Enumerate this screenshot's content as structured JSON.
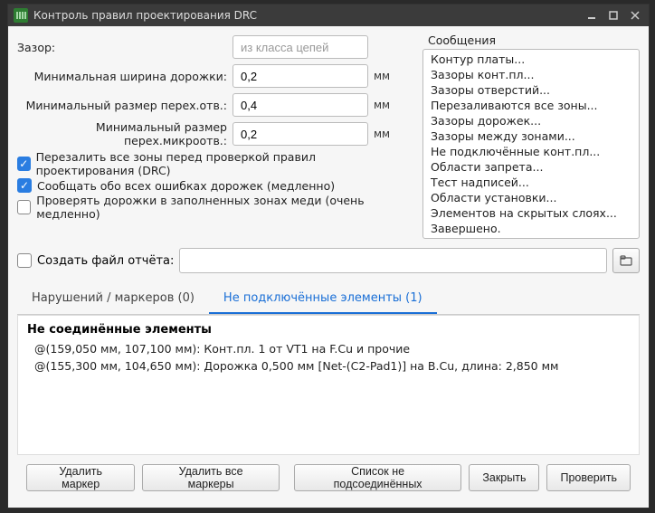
{
  "window": {
    "title": "Контроль правил проектирования DRC"
  },
  "form": {
    "clearance_label": "Зазор:",
    "clearance_placeholder": "из класса цепей",
    "clearance_value": "",
    "track_width_label": "Минимальная ширина дорожки:",
    "track_width_value": "0,2",
    "via_size_label": "Минимальный размер перех.отв.:",
    "via_size_value": "0,4",
    "uvia_size_label": "Минимальный размер перех.микроотв.:",
    "uvia_size_value": "0,2",
    "unit": "мм"
  },
  "checks": {
    "refill_zones": "Перезалить все зоны перед проверкой правил проектирования (DRC)",
    "report_all": "Сообщать обо всех ошибках дорожек (медленно)",
    "test_filled": "Проверять дорожки в заполненных зонах меди (очень медленно)"
  },
  "report": {
    "create_label": "Создать файл отчёта:",
    "value": ""
  },
  "messages": {
    "title": "Сообщения",
    "items": [
      "Контур платы...",
      "Зазоры конт.пл...",
      "Зазоры отверстий...",
      "Перезаливаются все зоны...",
      "Зазоры дорожек...",
      "Зазоры между зонами...",
      "Не подключённые конт.пл...",
      "Области запрета...",
      "Тест надписей...",
      "Области установки...",
      "Элементов на скрытых слоях...",
      "Завершено."
    ]
  },
  "tabs": {
    "violations": "Нарушений / маркеров (0)",
    "unconnected": "Не подключённые элементы (1)"
  },
  "results": {
    "heading": "Не соединённые элементы",
    "rows": [
      "@(159,050 мм, 107,100 мм): Конт.пл. 1 от VT1 на F.Cu и прочие",
      "@(155,300 мм, 104,650 мм): Дорожка 0,500 мм [Net-(C2-Pad1)] на B.Cu, длина: 2,850 мм"
    ]
  },
  "footer": {
    "delete_marker": "Удалить маркер",
    "delete_all": "Удалить все маркеры",
    "list_unconnected": "Список не подсоединённых",
    "close": "Закрыть",
    "run": "Проверить"
  }
}
